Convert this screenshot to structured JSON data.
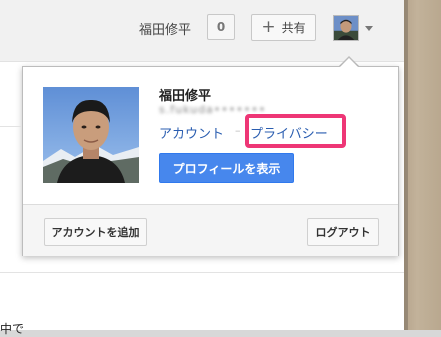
{
  "header": {
    "user_name": "福田修平",
    "notification_count": "0",
    "share_label": "共有",
    "share_icon": "plus-icon",
    "account_caret_icon": "chevron-down-icon"
  },
  "account_panel": {
    "full_name": "福田修平",
    "email_obscured": "s.fukuda•••••••",
    "account_link": "アカウント",
    "separator": "–",
    "privacy_link": "プライバシー",
    "view_profile_button": "プロフィールを表示",
    "add_account_button": "アカウントを追加",
    "logout_button": "ログアウト"
  },
  "page": {
    "cutoff_text": "中で"
  },
  "colors": {
    "accent_blue": "#4787ed",
    "link_blue": "#2a5db0",
    "highlight_pink": "#ee3676"
  }
}
